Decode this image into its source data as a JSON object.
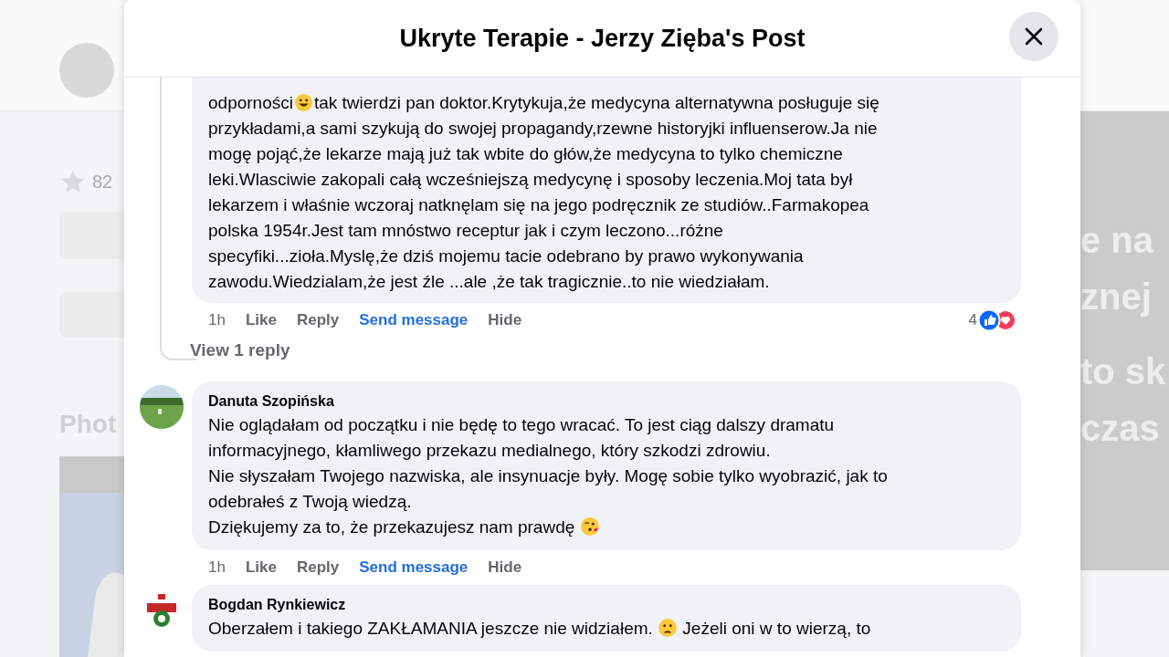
{
  "background_page": {
    "stat": "82",
    "section_heading": "Phot",
    "cover_lines": [
      "e na",
      "znej",
      "to sk",
      "czas"
    ]
  },
  "dialog": {
    "title": "Ukryte Terapie - Jerzy Zięba's Post"
  },
  "comments": [
    {
      "lines": [
        [
          {
            "kind": "text",
            "text": "odporności"
          },
          {
            "kind": "emoji"
          },
          {
            "kind": "text",
            "text": "tak twierdzi pan doktor.Krytykuja,że medycyna alternatywna posługuje się"
          }
        ],
        [
          {
            "kind": "text",
            "text": "przykładami,a sami szykują do swojej propagandy,rzewne historyjki influenserow.Ja nie"
          }
        ],
        [
          {
            "kind": "text",
            "text": "mogę pojąć,że lekarze mają już tak wbite do głów,że medycyna to tylko chemiczne"
          }
        ],
        [
          {
            "kind": "text",
            "text": "leki.Wlasciwie zakopali całą wcześniejszą medycynę i sposoby leczenia.Moj tata był"
          }
        ],
        [
          {
            "kind": "text",
            "text": "lekarzem i właśnie wczoraj natknęlam się na jego podręcznik ze studiów..Farmakopea"
          }
        ],
        [
          {
            "kind": "text",
            "text": "polska 1954r.Jest tam mnóstwo receptur jak i czym leczono...różne"
          }
        ],
        [
          {
            "kind": "text",
            "text": "specyfiki...zioła.Myslę,że dziś mojemu tacie odebrano by prawo wykonywania"
          }
        ],
        [
          {
            "kind": "text",
            "text": "zawodu.Wiedzialam,że jest źle ...ale ,że tak tragicznie..to nie wiedziałam."
          }
        ]
      ],
      "actions": [
        {
          "label": "1h",
          "kind": "time"
        },
        {
          "label": "Like",
          "kind": "action"
        },
        {
          "label": "Reply",
          "kind": "action"
        },
        {
          "label": "Send message",
          "kind": "primary"
        },
        {
          "label": "Hide",
          "kind": "action"
        }
      ],
      "reaction_count": "4",
      "replies_link": "View 1 reply"
    },
    {
      "author": "Danuta Szopińska",
      "avatar": {
        "kind": "picture"
      },
      "lines": [
        [
          {
            "kind": "text",
            "text": "Nie oglądałam od początku i nie będę to tego wracać. To jest ciąg dalszy dramatu"
          }
        ],
        [
          {
            "kind": "text",
            "text": "informacyjnego, kłamliwego przekazu medialnego, który szkodzi zdrowiu."
          }
        ],
        [
          {
            "kind": "text",
            "text": "Nie słyszałam Twojego nazwiska, ale insynuacje były. Mogę sobie tylko wyobrazić, jak to"
          }
        ],
        [
          {
            "kind": "text",
            "text": "odebrałeś z Twoją wiedzą."
          }
        ],
        [
          {
            "kind": "text",
            "text": "Dziękujemy za to, że przekazujesz nam prawdę "
          },
          {
            "kind": "emoji"
          }
        ]
      ],
      "actions": [
        {
          "label": "1h",
          "kind": "time"
        },
        {
          "label": "Like",
          "kind": "action"
        },
        {
          "label": "Reply",
          "kind": "action"
        },
        {
          "label": "Send message",
          "kind": "primary"
        },
        {
          "label": "Hide",
          "kind": "action"
        }
      ]
    },
    {
      "author": "Bogdan Rynkiewicz",
      "avatar": {
        "kind": "picture"
      },
      "lines": [
        [
          {
            "kind": "text",
            "text": "Oberzałem i takiego ZAKŁAMANIA jeszcze nie widziałem. "
          },
          {
            "kind": "emoji"
          },
          {
            "kind": "text",
            "text": " Jeżeli oni w to wierzą, to"
          }
        ]
      ]
    }
  ]
}
